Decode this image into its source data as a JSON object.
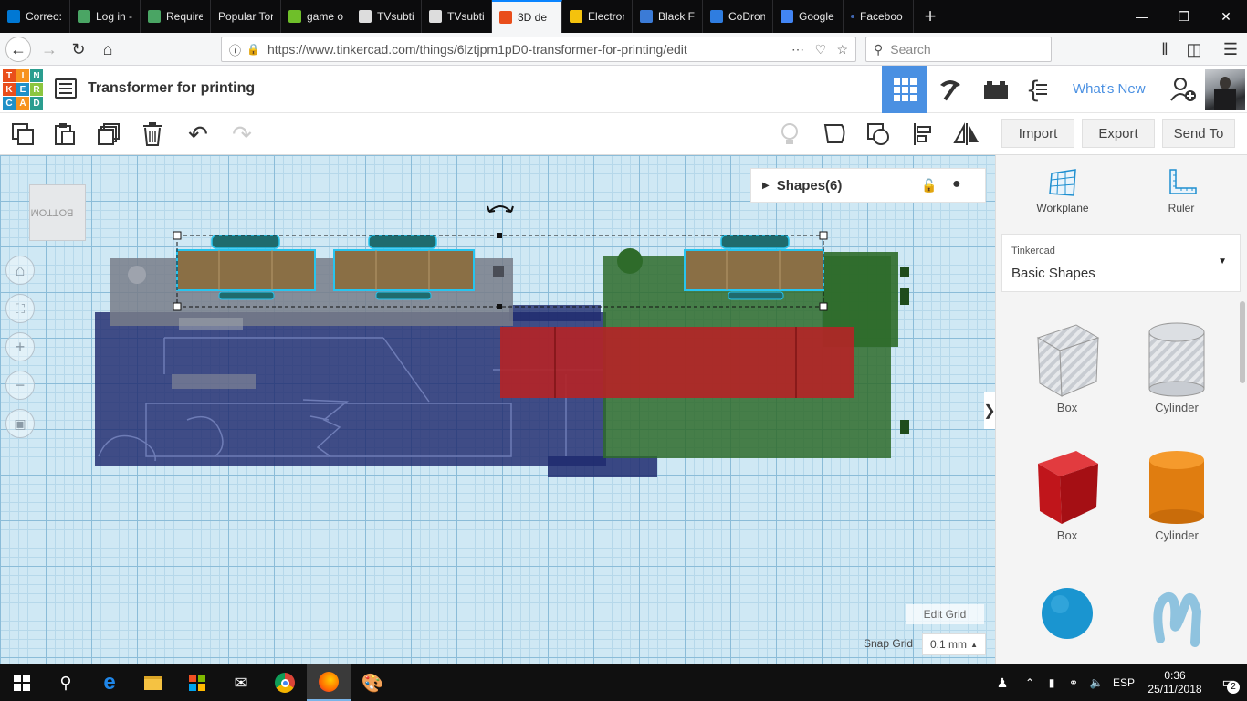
{
  "browser": {
    "tabs": [
      {
        "label": "Correo: N",
        "icon": "outlook-icon",
        "color": "#0078d4",
        "active": false
      },
      {
        "label": "Log in - ",
        "icon": "circle-icon",
        "color": "#4aa564",
        "active": false
      },
      {
        "label": "Required",
        "icon": "circle-icon",
        "color": "#4aa564",
        "active": false
      },
      {
        "label": "Popular Torr",
        "icon": "none",
        "color": "#333333",
        "active": false
      },
      {
        "label": "game of",
        "icon": "leaf-icon",
        "color": "#6fbf2a",
        "active": false
      },
      {
        "label": "TVsubtit",
        "icon": "film-icon",
        "color": "#dddddd",
        "active": false
      },
      {
        "label": "TVsubtit",
        "icon": "film-icon",
        "color": "#dddddd",
        "active": false
      },
      {
        "label": "3D de",
        "icon": "tinkercad-icon",
        "color": "#e94e1b",
        "active": true
      },
      {
        "label": "Electroni",
        "icon": "bars-icon",
        "color": "#f4c20d",
        "active": false
      },
      {
        "label": "Black Fri",
        "icon": "bolt-icon",
        "color": "#3b7bd6",
        "active": false
      },
      {
        "label": "CoDrone",
        "icon": "drone-icon",
        "color": "#2f7de0",
        "active": false
      },
      {
        "label": "Google T",
        "icon": "google-icon",
        "color": "#4285f4",
        "active": false
      },
      {
        "label": "Faceboo",
        "icon": "dot-icon",
        "color": "#4267b2",
        "active": false
      }
    ],
    "new_tab": "+",
    "url": "https://www.tinkercad.com/things/6lztjpm1pD0-transformer-for-printing/edit",
    "search_placeholder": "Search"
  },
  "app": {
    "logo_letters": [
      "T",
      "I",
      "N",
      "K",
      "E",
      "R",
      "C",
      "A",
      "D"
    ],
    "logo_colors": [
      "#e94e1b",
      "#f7931e",
      "#2a9d8f",
      "#e94e1b",
      "#1e90c8",
      "#8cc63f",
      "#1e90c8",
      "#f7931e",
      "#2a9d8f"
    ],
    "project_title": "Transformer for printing",
    "whats_new": "What's New",
    "accent": "#4a90e2"
  },
  "toolbar": {
    "import_label": "Import",
    "export_label": "Export",
    "send_to_label": "Send To"
  },
  "workplane": {
    "viewcube_label": "BOTTOM",
    "shapes_panel_label": "Shapes(6)",
    "edit_grid_label": "Edit Grid",
    "snap_grid_label": "Snap Grid",
    "snap_grid_value": "0.1 mm",
    "background": "#cfe8f4"
  },
  "right_panel": {
    "workplane_label": "Workplane",
    "ruler_label": "Ruler",
    "library_caption": "Tinkercad",
    "library_value": "Basic Shapes",
    "shapes": [
      {
        "name": "Box",
        "kind": "box-hole"
      },
      {
        "name": "Cylinder",
        "kind": "cylinder-hole"
      },
      {
        "name": "Box",
        "kind": "box-red"
      },
      {
        "name": "Cylinder",
        "kind": "cylinder-orange"
      },
      {
        "name": "",
        "kind": "sphere-blue"
      },
      {
        "name": "",
        "kind": "scribble"
      }
    ]
  },
  "taskbar": {
    "language": "ESP",
    "time": "0:36",
    "date": "25/11/2018",
    "notifications": "2"
  }
}
